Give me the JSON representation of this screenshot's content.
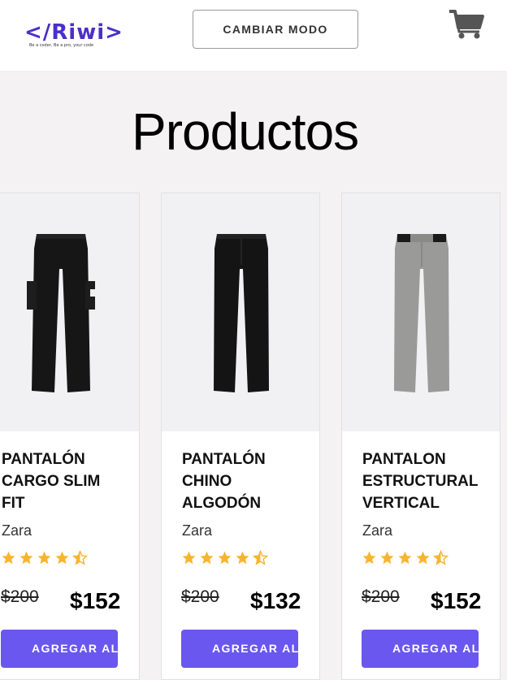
{
  "header": {
    "logo_text": "</Riwi>",
    "logo_tagline": "Be a coder, Be a pro, your code",
    "mode_button": "CAMBIAR MODO",
    "cart_icon": "cart-icon"
  },
  "main": {
    "title": "Productos"
  },
  "colors": {
    "accent": "#6a57ef",
    "logo": "#4b2fc9",
    "star": "#f7b52f"
  },
  "products": [
    {
      "name": "PANTALÓN CARGO SLIM FIT",
      "brand": "Zara",
      "rating": 4.5,
      "old_price": "$200",
      "price": "$152",
      "button": "AGREGAR AL CARRITO"
    },
    {
      "name": "PANTALÓN CHINO ALGODÓN",
      "brand": "Zara",
      "rating": 4.5,
      "old_price": "$200",
      "price": "$132",
      "button": "AGREGAR AL CARRITO"
    },
    {
      "name": "PANTALON ESTRUCTURAL VERTICAL",
      "brand": "Zara",
      "rating": 4.5,
      "old_price": "$200",
      "price": "$152",
      "button": "AGREGAR AL CARRITO"
    }
  ]
}
